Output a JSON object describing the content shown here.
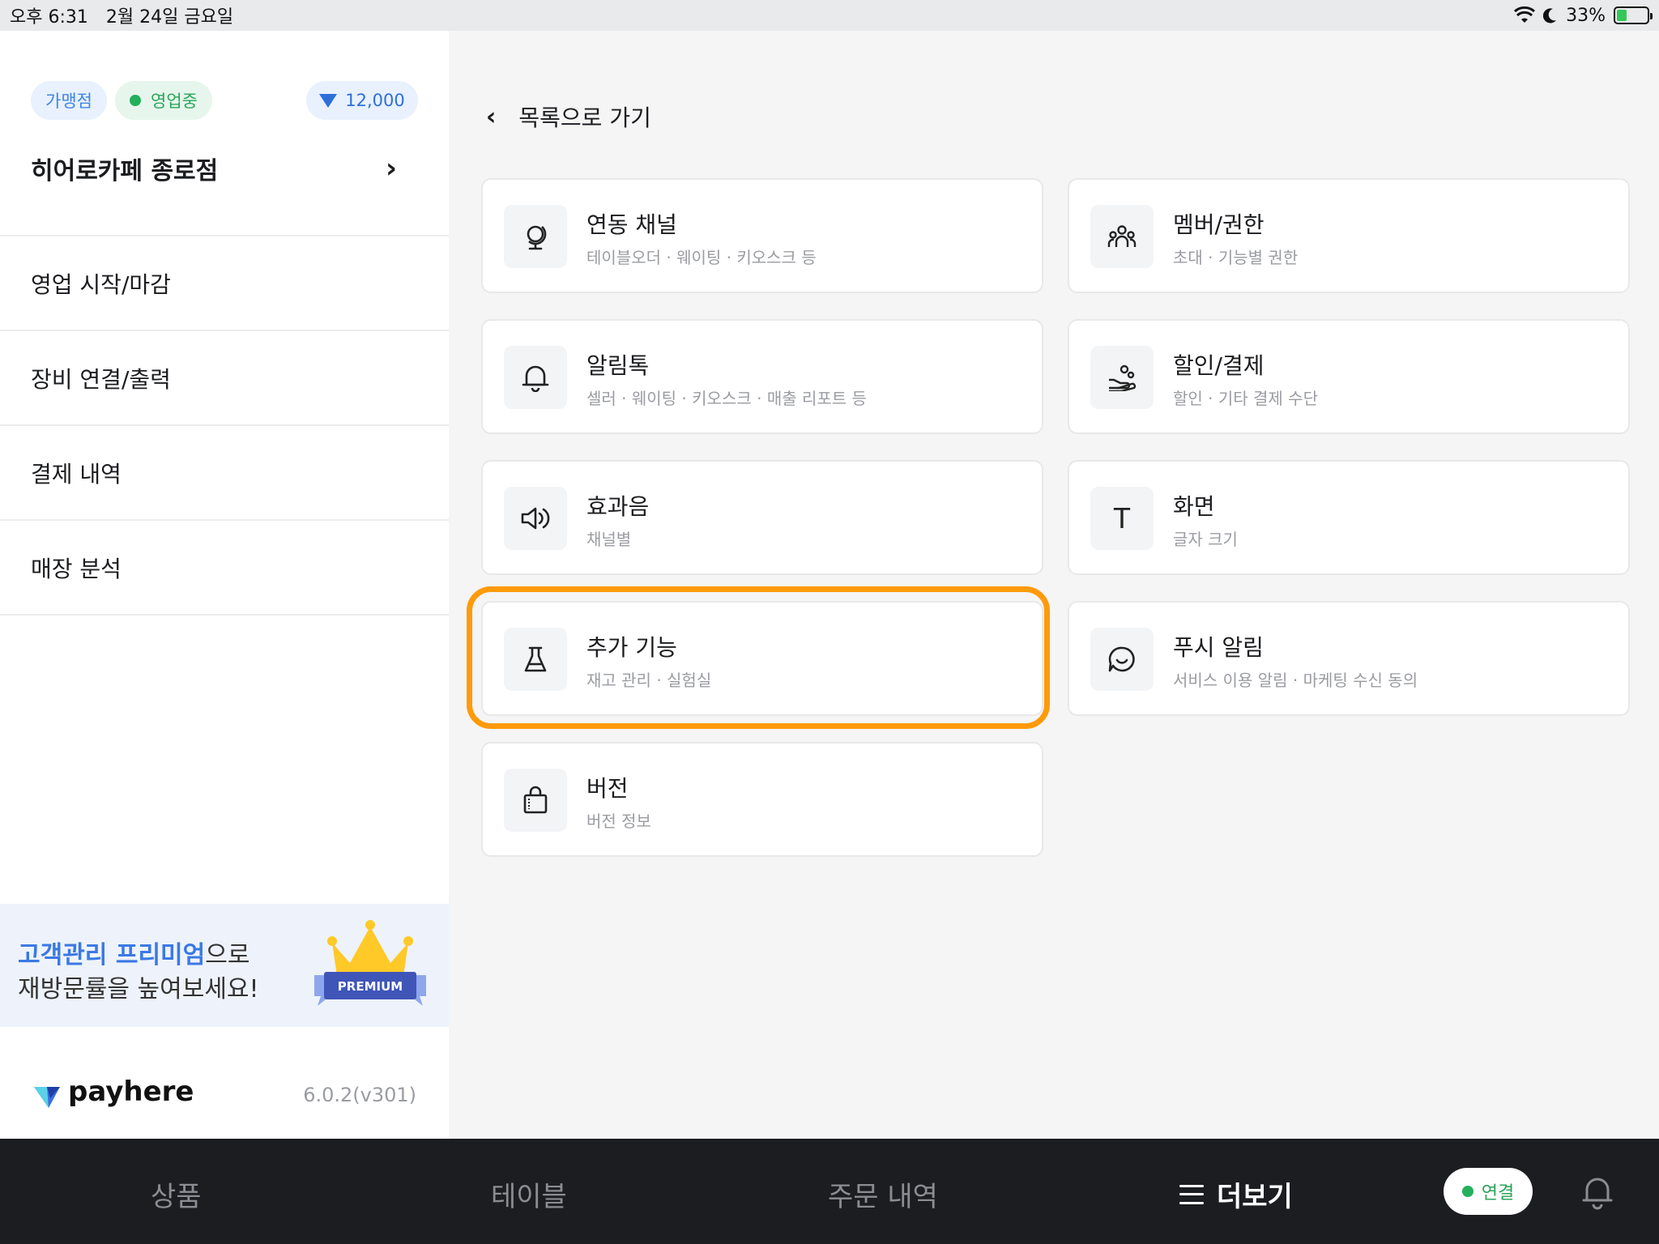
{
  "statusbar": {
    "time": "오후 6:31",
    "date": "2월 24일 금요일",
    "battery": "33%",
    "battery_level": 0.33
  },
  "sidebar": {
    "badges": {
      "franchise": "가맹점",
      "status": "영업중",
      "points": "12,000"
    },
    "store_name": "히어로카페 종로점",
    "menu": [
      {
        "label": "영업 시작/마감"
      },
      {
        "label": "장비 연결/출력"
      },
      {
        "label": "결제 내역"
      },
      {
        "label": "매장 분석"
      }
    ],
    "promo": {
      "highlight": "고객관리 프리미엄",
      "suffix": "으로",
      "line2": "재방문률을 높여보세요!",
      "badge": "PREMIUM"
    },
    "brand": {
      "name": "payhere",
      "version": "6.0.2(v301)"
    }
  },
  "main": {
    "back_label": "목록으로 가기",
    "cards": [
      {
        "title": "연동 채널",
        "desc": "테이블오더 · 웨이팅 · 키오스크 등",
        "icon": "globe-icon"
      },
      {
        "title": "멤버/권한",
        "desc": "초대 · 기능별 권한",
        "icon": "people-icon"
      },
      {
        "title": "알림톡",
        "desc": "셀러 · 웨이팅 · 키오스크 · 매출 리포트 등",
        "icon": "bell-icon"
      },
      {
        "title": "할인/결제",
        "desc": "할인 · 기타 결제 수단",
        "icon": "hand-coin-icon"
      },
      {
        "title": "효과음",
        "desc": "채널별",
        "icon": "speaker-icon"
      },
      {
        "title": "화면",
        "desc": "글자 크기",
        "icon": "text-size-icon",
        "glyph": "T"
      },
      {
        "title": "추가 기능",
        "desc": "재고 관리 · 실험실",
        "icon": "flask-icon"
      },
      {
        "title": "푸시 알림",
        "desc": "서비스 이용 알림 · 마케팅 수신 동의",
        "icon": "chat-smile-icon"
      },
      {
        "title": "버전",
        "desc": "버전 정보",
        "icon": "bag-icon"
      }
    ],
    "highlight_color": "#ff9a0a"
  },
  "bottomnav": {
    "tabs": [
      {
        "label": "상품"
      },
      {
        "label": "테이블"
      },
      {
        "label": "주문 내역"
      },
      {
        "label": "더보기"
      }
    ],
    "connect": "연결"
  }
}
